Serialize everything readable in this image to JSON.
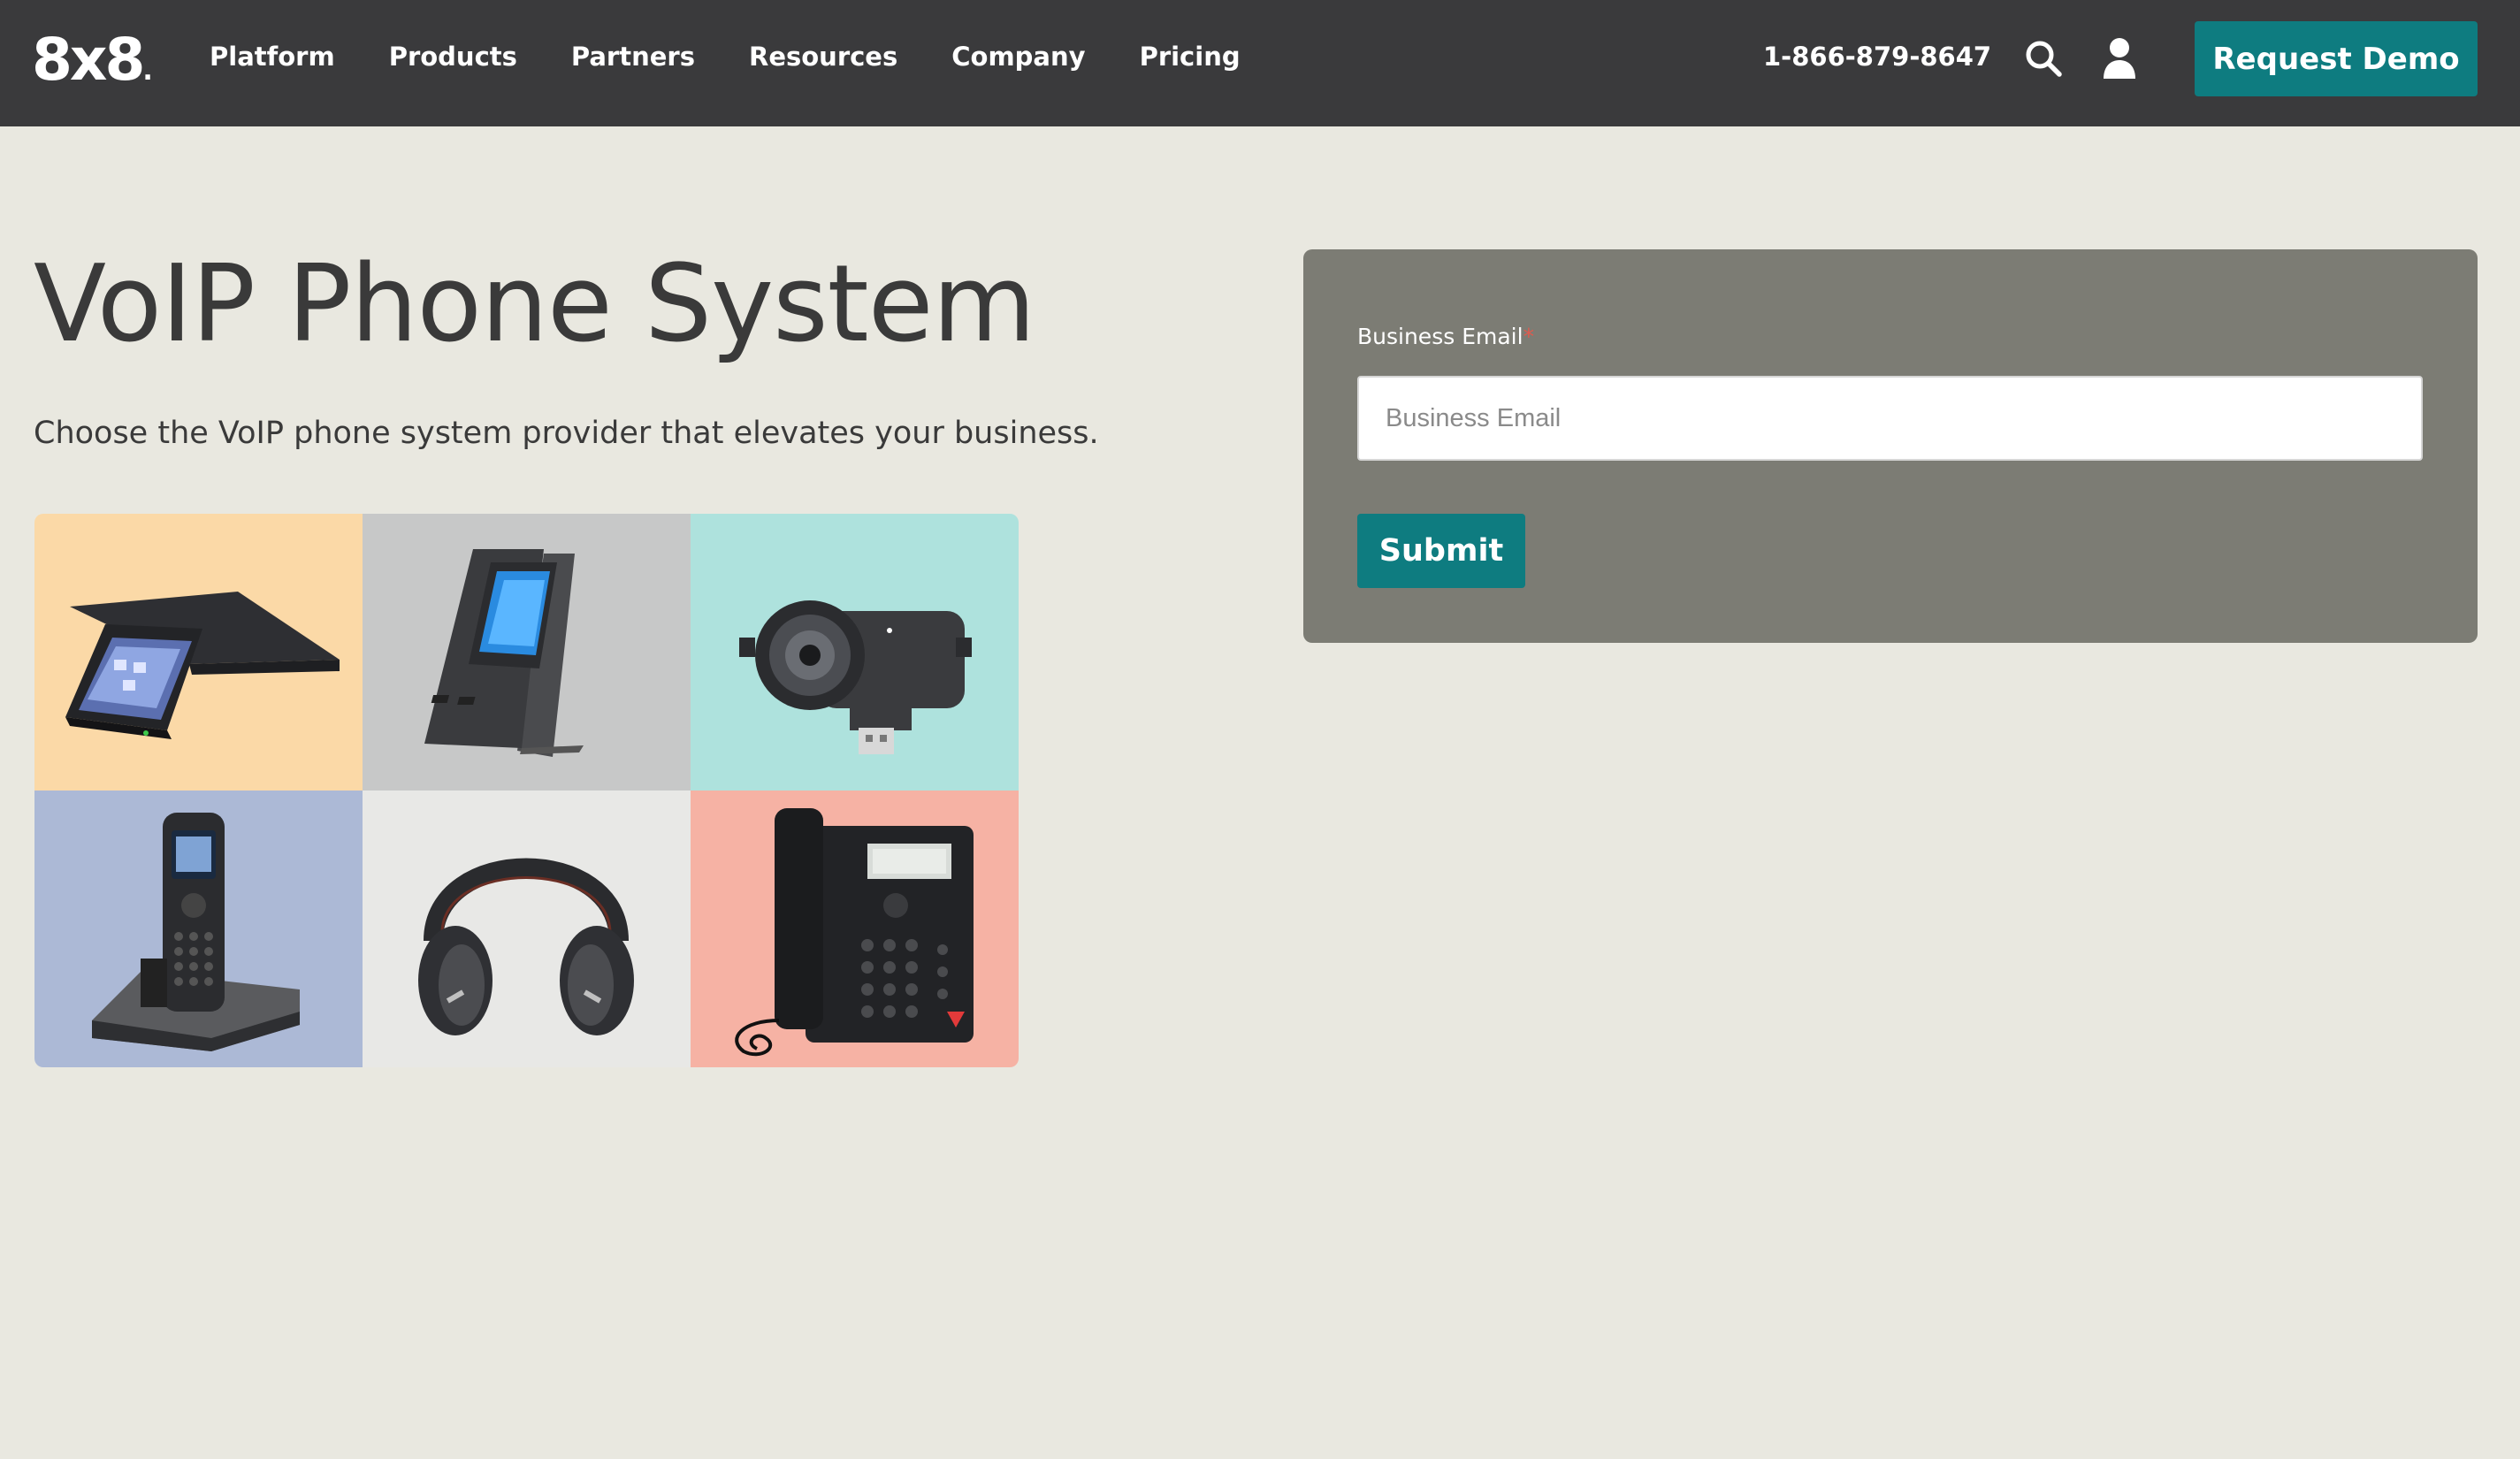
{
  "header": {
    "logo_text": "8x8",
    "logo_dot": ".",
    "nav": [
      {
        "label": "Platform"
      },
      {
        "label": "Products"
      },
      {
        "label": "Partners"
      },
      {
        "label": "Resources"
      },
      {
        "label": "Company"
      },
      {
        "label": "Pricing"
      }
    ],
    "phone": "1-866-879-8647",
    "search_icon": "search-icon",
    "user_icon": "user-icon",
    "cta_label": "Request Demo",
    "colors": {
      "bar": "#3a3a3c",
      "accent": "#0e7c80"
    }
  },
  "hero": {
    "title": "VoIP Phone System",
    "subtitle": "Choose the VoIP phone system provider that elevates your business.",
    "products": [
      {
        "name": "conference-phone",
        "bg": "#fbd9a7"
      },
      {
        "name": "expansion-module",
        "bg": "#c7c8c8"
      },
      {
        "name": "usb-camera",
        "bg": "#aee2dd"
      },
      {
        "name": "cordless-phone",
        "bg": "#acb9d6"
      },
      {
        "name": "headset",
        "bg": "#e8e8e6"
      },
      {
        "name": "desk-phone",
        "bg": "#f6b2a4"
      }
    ]
  },
  "form": {
    "label": "Business Email",
    "required_mark": "*",
    "placeholder": "Business Email",
    "value": "",
    "submit_label": "Submit",
    "panel_color": "#7c7c74"
  }
}
